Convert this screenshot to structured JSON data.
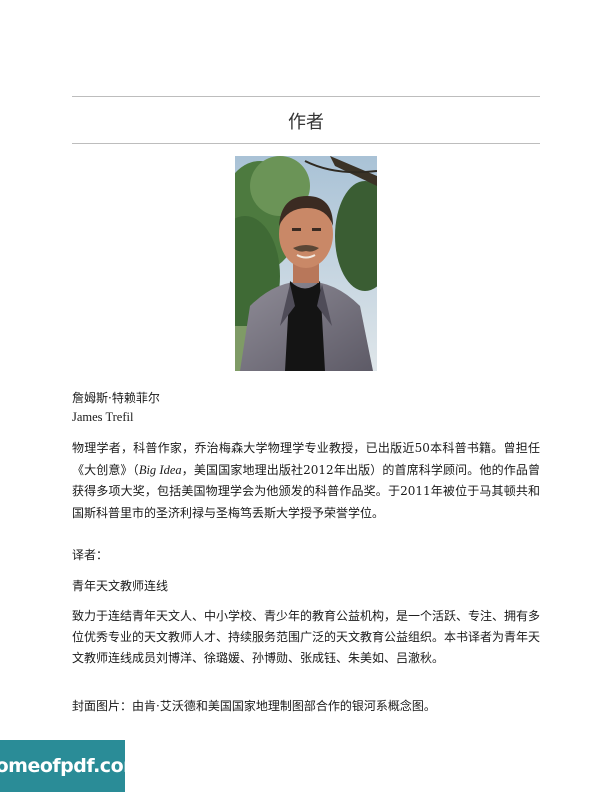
{
  "heading": "作者",
  "author": {
    "name_cn": "詹姆斯·特赖菲尔",
    "name_en": "James Trefil",
    "bio_part1": "物理学者，科普作家，乔治梅森大学物理学专业教授，已出版近50本科普书籍。曾担任《大创意》（",
    "bio_italic": "Big Idea",
    "bio_part2": "，美国国家地理出版社2012年出版）的首席科学顾问。他的作品曾获得多项大奖，包括美国物理学会为他颁发的科普作品奖。于2011年被位于马其顿共和国斯科普里市的圣济利禄与圣梅笃丢斯大学授予荣誉学位。"
  },
  "translator": {
    "label": "译者：",
    "name": "青年天文教师连线",
    "description": "致力于连结青年天文人、中小学校、青少年的教育公益机构，是一个活跃、专注、拥有多位优秀专业的天文教师人才、持续服务范围广泛的天文教育公益组织。本书译者为青年天文教师连线成员刘博洋、徐璐媛、孙博勋、张成钰、朱美如、吕澈秋。"
  },
  "cover_note": "封面图片：由肯·艾沃德和美国国家地理制图部合作的银河系概念图。",
  "watermark": "homeofpdf.com",
  "colors": {
    "watermark_bg": "#2a8c97",
    "rule": "#bdbdbd"
  }
}
